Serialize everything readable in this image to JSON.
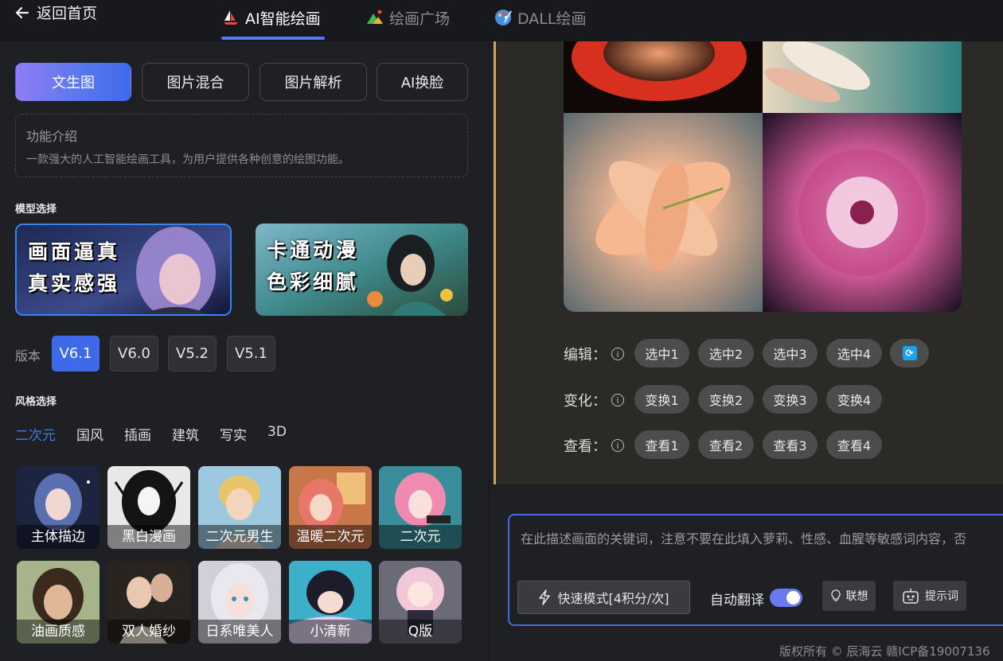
{
  "nav": {
    "back_label": "返回首页",
    "tabs": [
      {
        "label": "AI智能绘画",
        "icon": "sailboat-icon",
        "active": true
      },
      {
        "label": "绘画广场",
        "icon": "mountain-icon",
        "active": false
      },
      {
        "label": "DALL绘画",
        "icon": "palette-icon",
        "active": false
      }
    ]
  },
  "modes": [
    "文生图",
    "图片混合",
    "图片解析",
    "AI换脸"
  ],
  "intro": {
    "title": "功能介绍",
    "desc": "一款强大的人工智能绘画工具，为用户提供各种创意的绘图功能。"
  },
  "model_section": {
    "label": "模型选择",
    "models": [
      {
        "line1": "画面逼真",
        "line2": "真实感强",
        "selected": true
      },
      {
        "line1": "卡通动漫",
        "line2": "色彩细腻",
        "selected": false
      }
    ]
  },
  "version": {
    "label": "版本",
    "options": [
      "V6.1",
      "V6.0",
      "V5.2",
      "V5.1"
    ],
    "selected": "V6.1"
  },
  "style_section": {
    "label": "风格选择",
    "tabs": [
      "二次元",
      "国风",
      "插画",
      "建筑",
      "写实",
      "3D"
    ],
    "active_tab": "二次元",
    "cards": [
      "主体描边",
      "黑白漫画",
      "二次元男生",
      "温暖二次元",
      "二次元",
      "油画质感",
      "双人婚纱",
      "日系唯美人",
      "小清新",
      "Q版"
    ]
  },
  "controls": {
    "edit": {
      "label": "编辑：",
      "buttons": [
        "选中1",
        "选中2",
        "选中3",
        "选中4"
      ]
    },
    "vary": {
      "label": "变化：",
      "buttons": [
        "变换1",
        "变换2",
        "变换3",
        "变换4"
      ]
    },
    "view": {
      "label": "查看：",
      "buttons": [
        "查看1",
        "查看2",
        "查看3",
        "查看4"
      ]
    },
    "refresh_icon": "refresh-icon"
  },
  "prompt": {
    "placeholder": "在此描述画面的关键词，注意不要在此填入萝莉、性感、血腥等敏感词内容，否",
    "fast_mode_label": "快速模式[4积分/次]",
    "auto_translate_label": "自动翻译",
    "auto_translate_on": true,
    "associate_label": "联想",
    "prompt_words_label": "提示词"
  },
  "footer": {
    "copyright": "版权所有 © 辰海云  赣ICP备19007136"
  },
  "colors": {
    "accent": "#3e6ae9",
    "gold_border": "#c7a55a",
    "background": "#1f2024"
  }
}
